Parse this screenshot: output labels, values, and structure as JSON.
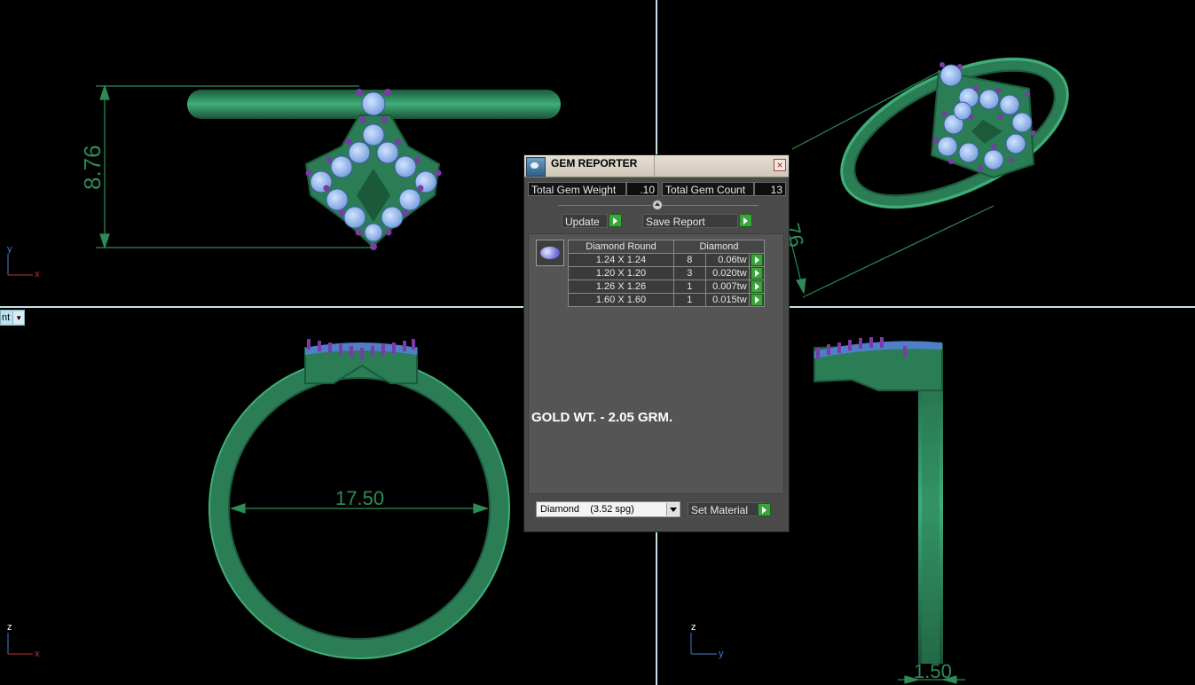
{
  "viewports": {
    "top_left": {
      "dimension": "8.76",
      "axis_a": "y",
      "axis_b": "x"
    },
    "top_right": {
      "dimension_fragment": "76"
    },
    "bottom_left": {
      "dimension": "17.50",
      "axis_a": "z",
      "axis_b": "x"
    },
    "bottom_right": {
      "dimension": "1.50",
      "axis_a": "z",
      "axis_b": "y"
    },
    "view_combo": {
      "label": "nt",
      "dropdown_icon": "chevron-down-icon"
    }
  },
  "gem_reporter": {
    "title": "GEM REPORTER",
    "total_gem_weight_label": "Total Gem Weight",
    "total_gem_weight_value": ".10",
    "total_gem_count_label": "Total Gem Count",
    "total_gem_count_value": "13",
    "update_label": "Update",
    "save_report_label": "Save Report",
    "table": {
      "headers": [
        "Diamond Round",
        "Diamond"
      ],
      "rows": [
        {
          "size": "1.24 X 1.24",
          "count": "8",
          "weight": "0.06tw"
        },
        {
          "size": "1.20 X 1.20",
          "count": "3",
          "weight": "0.020tw"
        },
        {
          "size": "1.26 X 1.26",
          "count": "1",
          "weight": "0.007tw"
        },
        {
          "size": "1.60 X 1.60",
          "count": "1",
          "weight": "0.015tw"
        }
      ]
    },
    "note": "GOLD WT. - 2.05 GRM.",
    "material": "Diamond    (3.52 spg)",
    "set_material_label": "Set Material"
  },
  "colors": {
    "background": "#000000",
    "metal": "#2e8b57",
    "gem_blue": "#9ec2f0",
    "prong_purple": "#7a3aa8",
    "viewport_divider": "#c6dfe7",
    "panel_bg": "#4a4a4a",
    "accent_green": "#3aa53a"
  }
}
